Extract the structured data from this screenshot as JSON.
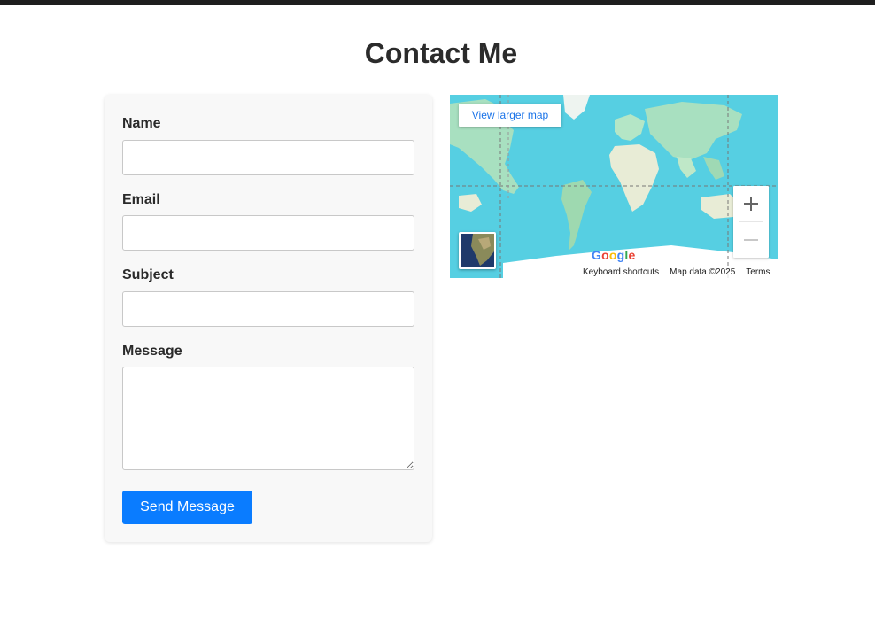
{
  "page": {
    "title": "Contact Me"
  },
  "form": {
    "name_label": "Name",
    "name_value": "",
    "email_label": "Email",
    "email_value": "",
    "subject_label": "Subject",
    "subject_value": "",
    "message_label": "Message",
    "message_value": "",
    "submit_label": "Send Message"
  },
  "map": {
    "view_larger_label": "View larger map",
    "zoom_in_icon": "plus-icon",
    "zoom_out_icon": "minus-icon",
    "brand": "Google",
    "keyboard_shortcuts": "Keyboard shortcuts",
    "map_data": "Map data ©2025",
    "terms": "Terms"
  },
  "colors": {
    "accent": "#0a7cff",
    "ocean": "#56cfe2",
    "land": "#a8e0c0",
    "topbar": "#1e1e1e"
  }
}
